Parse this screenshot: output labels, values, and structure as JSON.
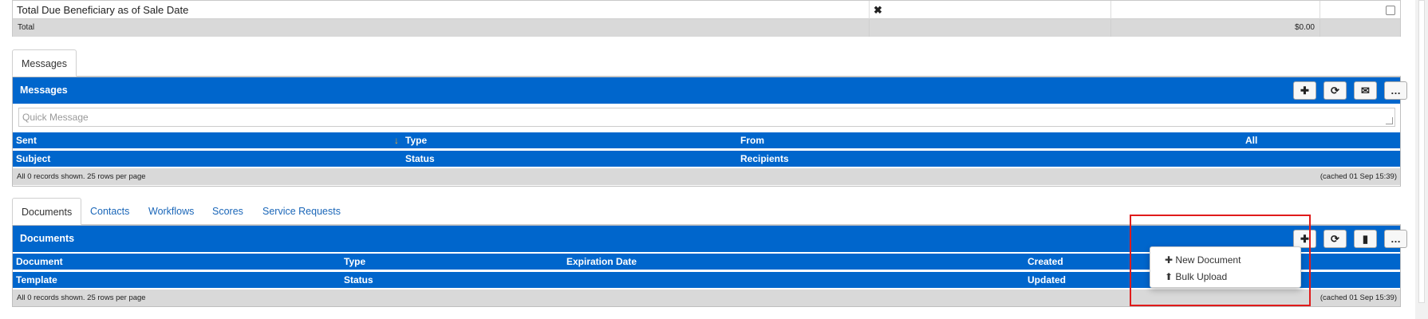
{
  "top_table": {
    "row_label": "Total Due Beneficiary as of Sale Date",
    "row_mark": "✖",
    "total_label": "Total",
    "total_value": "$0.00"
  },
  "messages": {
    "tab": "Messages",
    "title": "Messages",
    "quick_placeholder": "Quick Message",
    "buttons": [
      "✚",
      "⟳",
      "✉",
      "…"
    ],
    "columns_row1": [
      "Sent",
      "Type",
      "From",
      "All"
    ],
    "sort_indicator": "↓",
    "columns_row2": [
      "Subject",
      "Status",
      "Recipients"
    ],
    "footer_left": "All 0 records shown. 25 rows per page",
    "footer_right": "(cached 01 Sep 15:39)"
  },
  "lower_tabs": [
    "Documents",
    "Contacts",
    "Workflows",
    "Scores",
    "Service Requests"
  ],
  "documents": {
    "title": "Documents",
    "buttons": [
      "✚",
      "⟳",
      "▮",
      "…"
    ],
    "columns_row1": [
      "Document",
      "Type",
      "Expiration Date",
      "Created"
    ],
    "columns_row2": [
      "Template",
      "Status",
      "Updated"
    ],
    "footer_left": "All 0 records shown. 25 rows per page",
    "footer_right": "(cached 01 Sep 15:39)",
    "dropdown": {
      "items": [
        {
          "icon": "✚",
          "label": "New Document"
        },
        {
          "icon": "⬆",
          "label": "Bulk Upload"
        }
      ]
    }
  },
  "colors": {
    "header_blue": "#0066cc",
    "footer_gray": "#d9d9d9",
    "highlight_red": "#e01b1b"
  }
}
